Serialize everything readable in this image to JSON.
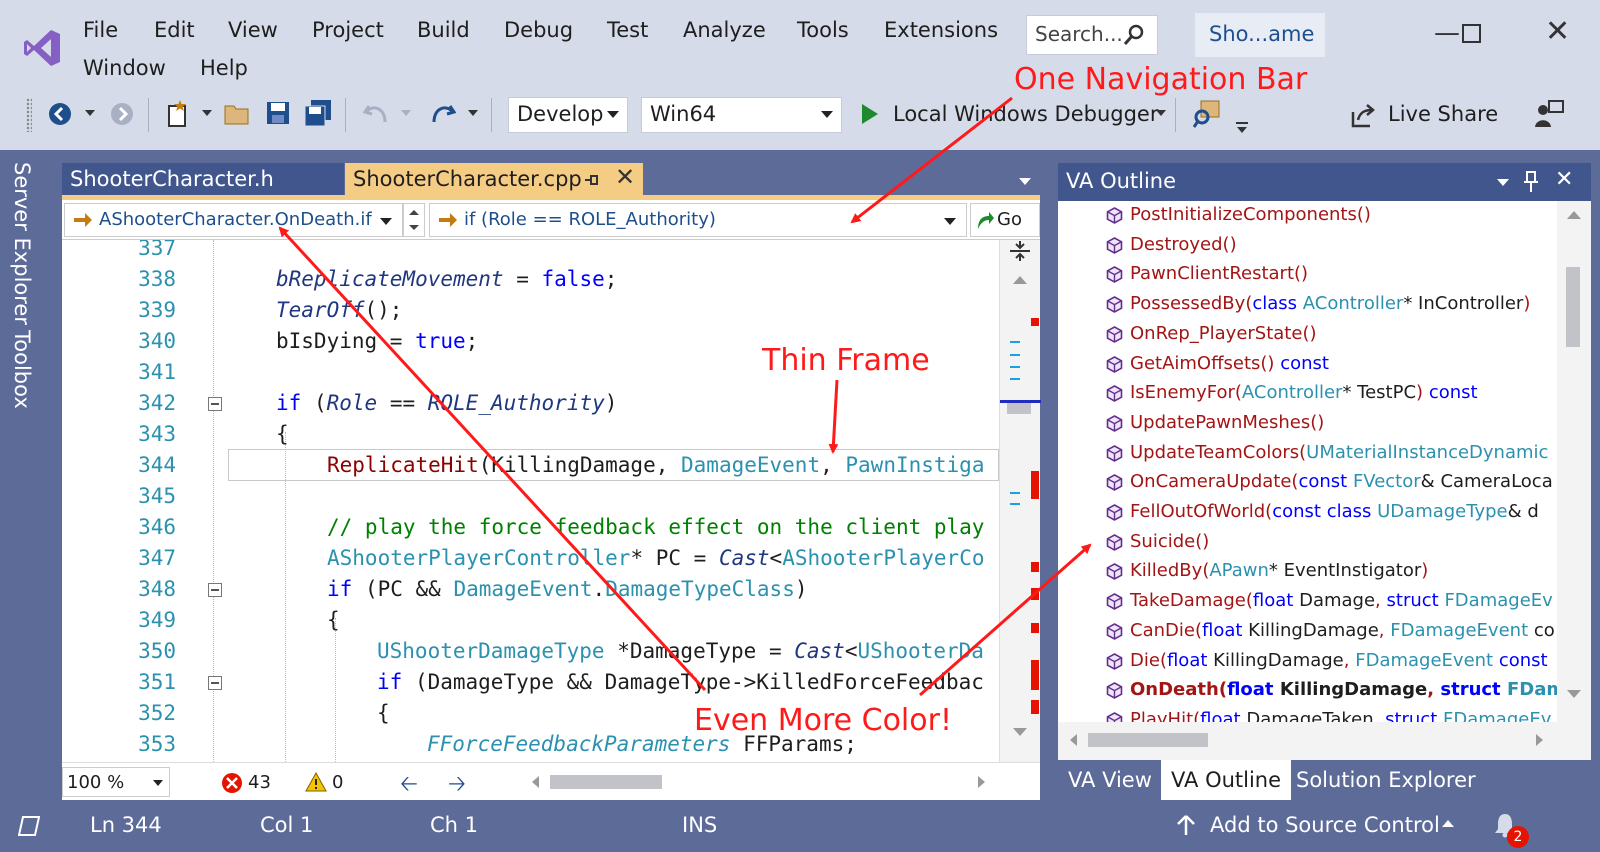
{
  "menu": [
    "File",
    "Edit",
    "View",
    "Project",
    "Build",
    "Debug",
    "Test",
    "Analyze",
    "Tools",
    "Extensions",
    "Window",
    "Help"
  ],
  "search_placeholder": "Search...",
  "solution_short_name": "Sho...ame",
  "toolbar": {
    "configuration": "Develop",
    "platform": "Win64",
    "debugger": "Local Windows Debugger",
    "live_share": "Live Share"
  },
  "left_tabs": [
    "Server Explorer",
    "Toolbox"
  ],
  "editor": {
    "tabs": [
      {
        "label": "ShooterCharacter.h",
        "active": false
      },
      {
        "label": "ShooterCharacter.cpp",
        "active": true
      }
    ],
    "nav_scope": "AShooterCharacter.OnDeath.if",
    "nav_member": "if (Role == ROLE_Authority)",
    "nav_go": "Go",
    "zoom": "100 %",
    "error_count": "43",
    "warning_count": "0",
    "line_numbers": [
      "337",
      "338",
      "339",
      "340",
      "341",
      "342",
      "343",
      "344",
      "345",
      "346",
      "347",
      "348",
      "349",
      "350",
      "351",
      "352",
      "353"
    ]
  },
  "va_outline": {
    "title": "VA Outline",
    "items": [
      "PostInitializeComponents()",
      "Destroyed()",
      "PawnClientRestart()",
      "PossessedBy(class AController* InController)",
      "OnRep_PlayerState()",
      "GetAimOffsets() const",
      "IsEnemyFor(AController* TestPC) const",
      "UpdatePawnMeshes()",
      "UpdateTeamColors(UMaterialInstanceDynamic",
      "OnCameraUpdate(const FVector& CameraLoca",
      "FellOutOfWorld(const class UDamageType& d",
      "Suicide()",
      "KilledBy(APawn* EventInstigator)",
      "TakeDamage(float Damage, struct FDamageEv",
      "CanDie(float KillingDamage, FDamageEvent co",
      "Die(float KillingDamage, FDamageEvent const",
      "OnDeath(float KillingDamage, struct FDama",
      "PlayHit(float DamageTaken, struct FDamageEv"
    ],
    "bottom_tabs": [
      "VA View",
      "VA Outline",
      "Solution Explorer"
    ]
  },
  "status": {
    "line": "Ln 344",
    "col": "Col 1",
    "ch": "Ch 1",
    "mode": "INS",
    "source_control": "Add to Source Control",
    "notifications": "2"
  },
  "annotations": {
    "nav": "One Navigation Bar",
    "frame": "Thin Frame",
    "color": "Even More Color!"
  },
  "colors": {
    "accent": "#5d6b99",
    "active_tab": "#f5cc84",
    "annotation": "#ff1a1a"
  }
}
